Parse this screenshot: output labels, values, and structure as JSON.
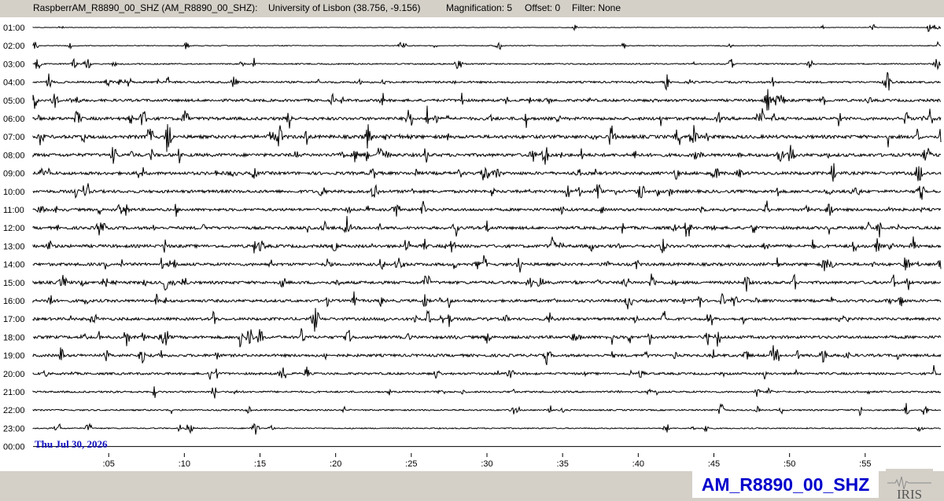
{
  "header": {
    "title": "RaspberrAM_R8890_00_SHZ (AM_R8890_00_SHZ):",
    "location": "University of Lisbon (38.756, -9.156)",
    "magnification": "Magnification: 5",
    "offset": "Offset: 0",
    "filter": "Filter: None"
  },
  "station_label": "AM_R8890_00_SHZ",
  "logo_text": "IRIS",
  "date_label": "Thu Jul 30, 2026",
  "colors": {
    "trace": "#000000",
    "date_text": "#1010c0",
    "station_text": "#0000cc",
    "last_line": "#1010c0"
  },
  "chart_data": {
    "type": "line",
    "title": "RaspberrAM_R8890_00_SHZ (AM_R8890_00_SHZ):",
    "rows": [
      "01:00",
      "02:00",
      "03:00",
      "04:00",
      "05:00",
      "06:00",
      "07:00",
      "08:00",
      "09:00",
      "10:00",
      "11:00",
      "12:00",
      "13:00",
      "14:00",
      "15:00",
      "16:00",
      "17:00",
      "18:00",
      "19:00",
      "20:00",
      "21:00",
      "22:00",
      "23:00",
      "00:00"
    ],
    "x_ticks": [
      ":05",
      ":10",
      ":15",
      ":20",
      ":25",
      ":30",
      ":35",
      ":40",
      ":45",
      ":50",
      ":55"
    ],
    "xlim": [
      0,
      60
    ],
    "noise_level": [
      0.3,
      0.5,
      0.8,
      1.2,
      1.6,
      1.9,
      2.1,
      2.0,
      1.9,
      1.8,
      1.7,
      1.8,
      1.9,
      1.8,
      1.8,
      1.7,
      1.7,
      1.8,
      1.7,
      1.4,
      1.1,
      0.9,
      0.7,
      0.0
    ],
    "grid": false
  }
}
